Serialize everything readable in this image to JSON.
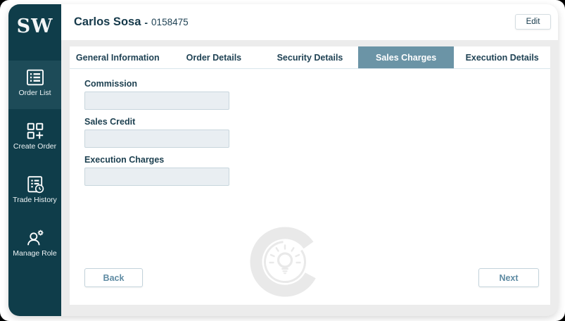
{
  "brand": {
    "logo_text": "SW"
  },
  "sidebar": {
    "items": [
      {
        "label": "Order List",
        "icon": "order-list-icon",
        "active": true
      },
      {
        "label": "Create Order",
        "icon": "create-order-icon",
        "active": false
      },
      {
        "label": "Trade History",
        "icon": "trade-history-icon",
        "active": false
      },
      {
        "label": "Manage Role",
        "icon": "manage-role-icon",
        "active": false
      }
    ]
  },
  "header": {
    "user_name": "Carlos Sosa",
    "separator": "-",
    "user_id": "0158475",
    "edit_button": "Edit"
  },
  "tabs": [
    {
      "label": "General Information",
      "active": false
    },
    {
      "label": "Order Details",
      "active": false
    },
    {
      "label": "Security Details",
      "active": false
    },
    {
      "label": "Sales Charges",
      "active": true
    },
    {
      "label": "Execution Details",
      "active": false
    }
  ],
  "form": {
    "fields": [
      {
        "label": "Commission",
        "value": "",
        "placeholder": ""
      },
      {
        "label": "Sales Credit",
        "value": "",
        "placeholder": ""
      },
      {
        "label": "Execution Charges",
        "value": "",
        "placeholder": ""
      }
    ]
  },
  "footer": {
    "back_button": "Back",
    "next_button": "Next"
  },
  "colors": {
    "sidebar": "#0f3d4a",
    "sidebar_active_item": "#1d4b58",
    "active_tab": "#6b94a6",
    "heading_text": "#15394a",
    "nav_button_text": "#5f8ba3",
    "input_bg": "#e9eef2",
    "watermark": "#e9e9e9"
  }
}
